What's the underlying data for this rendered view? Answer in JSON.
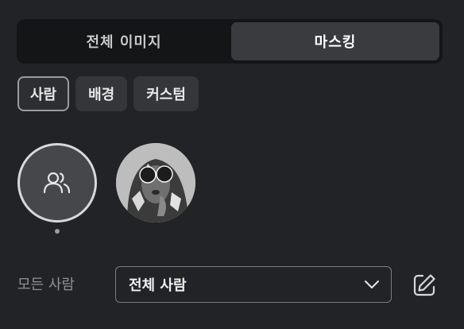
{
  "tabs": [
    {
      "label": "전체 이미지",
      "active": false
    },
    {
      "label": "마스킹",
      "active": true
    }
  ],
  "chips": [
    {
      "label": "사람",
      "active": true
    },
    {
      "label": "배경",
      "active": false
    },
    {
      "label": "커스텀",
      "active": false
    }
  ],
  "faces": [
    {
      "icon": "people-icon",
      "selected": true
    },
    {
      "icon": "person-thumbnail",
      "selected": false
    }
  ],
  "filter": {
    "label": "모든 사람",
    "selected": "전체 사람",
    "icon": "chevron-down-icon",
    "edit_icon": "edit-icon"
  },
  "colors": {
    "background": "#212326",
    "tab_bar": "#141516",
    "active_tab": "#3a3b3e",
    "chip": "#34363a"
  }
}
